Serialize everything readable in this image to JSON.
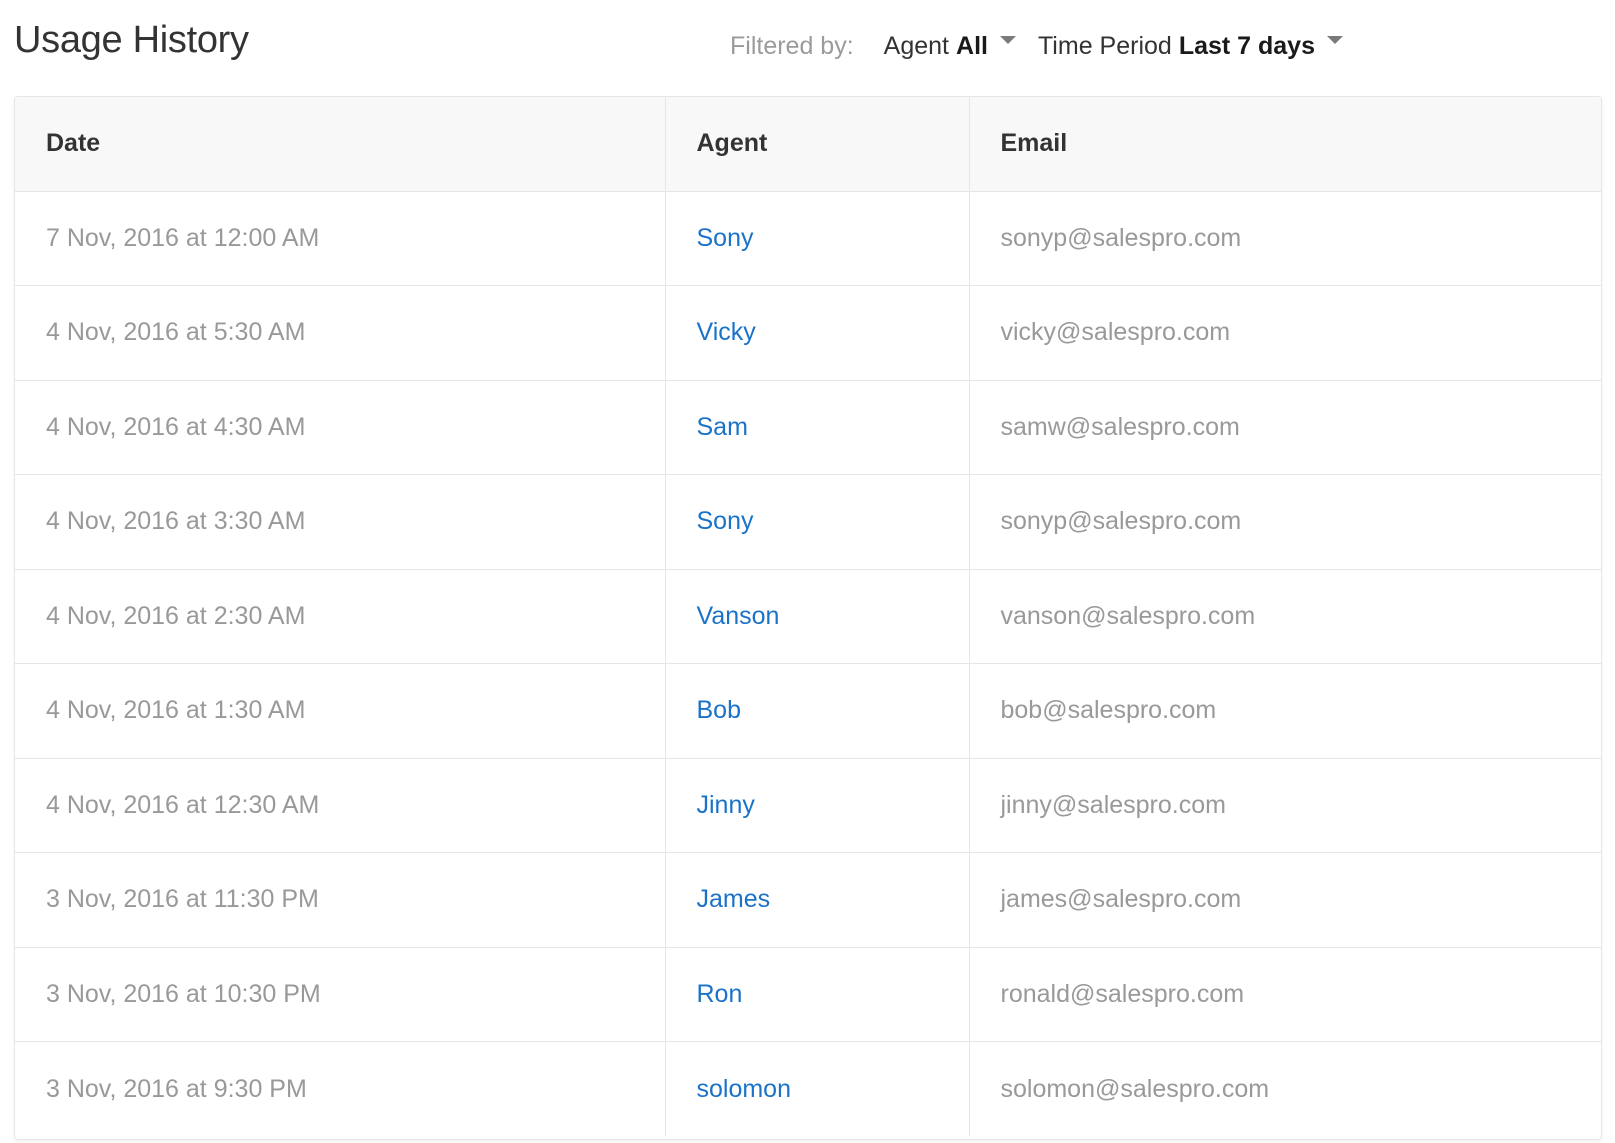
{
  "page": {
    "title": "Usage History"
  },
  "filters": {
    "label": "Filtered by:",
    "agent": {
      "name": "Agent",
      "value": "All"
    },
    "time_period": {
      "name": "Time Period",
      "value": "Last 7 days"
    }
  },
  "table": {
    "headers": {
      "date": "Date",
      "agent": "Agent",
      "email": "Email"
    },
    "rows": [
      {
        "date": "7 Nov, 2016 at 12:00 AM",
        "agent": "Sony",
        "email": "sonyp@salespro.com"
      },
      {
        "date": "4 Nov, 2016 at 5:30 AM",
        "agent": "Vicky",
        "email": "vicky@salespro.com"
      },
      {
        "date": "4 Nov, 2016 at 4:30 AM",
        "agent": "Sam",
        "email": "samw@salespro.com"
      },
      {
        "date": "4 Nov, 2016 at 3:30 AM",
        "agent": "Sony",
        "email": "sonyp@salespro.com"
      },
      {
        "date": "4 Nov, 2016 at 2:30 AM",
        "agent": "Vanson",
        "email": "vanson@salespro.com"
      },
      {
        "date": "4 Nov, 2016 at 1:30 AM",
        "agent": "Bob",
        "email": "bob@salespro.com"
      },
      {
        "date": "4 Nov, 2016 at 12:30 AM",
        "agent": "Jinny",
        "email": "jinny@salespro.com"
      },
      {
        "date": "3 Nov, 2016 at 11:30 PM",
        "agent": "James",
        "email": "james@salespro.com"
      },
      {
        "date": "3 Nov, 2016 at 10:30 PM",
        "agent": "Ron",
        "email": "ronald@salespro.com"
      },
      {
        "date": "3 Nov, 2016 at 9:30 PM",
        "agent": "solomon",
        "email": "solomon@salespro.com"
      }
    ]
  },
  "colors": {
    "link": "#1a73c8",
    "muted_text": "#999999",
    "header_bg": "#f8f8f8",
    "border": "#e6e6e6"
  },
  "icons": {
    "dropdown": "caret-down-icon"
  }
}
